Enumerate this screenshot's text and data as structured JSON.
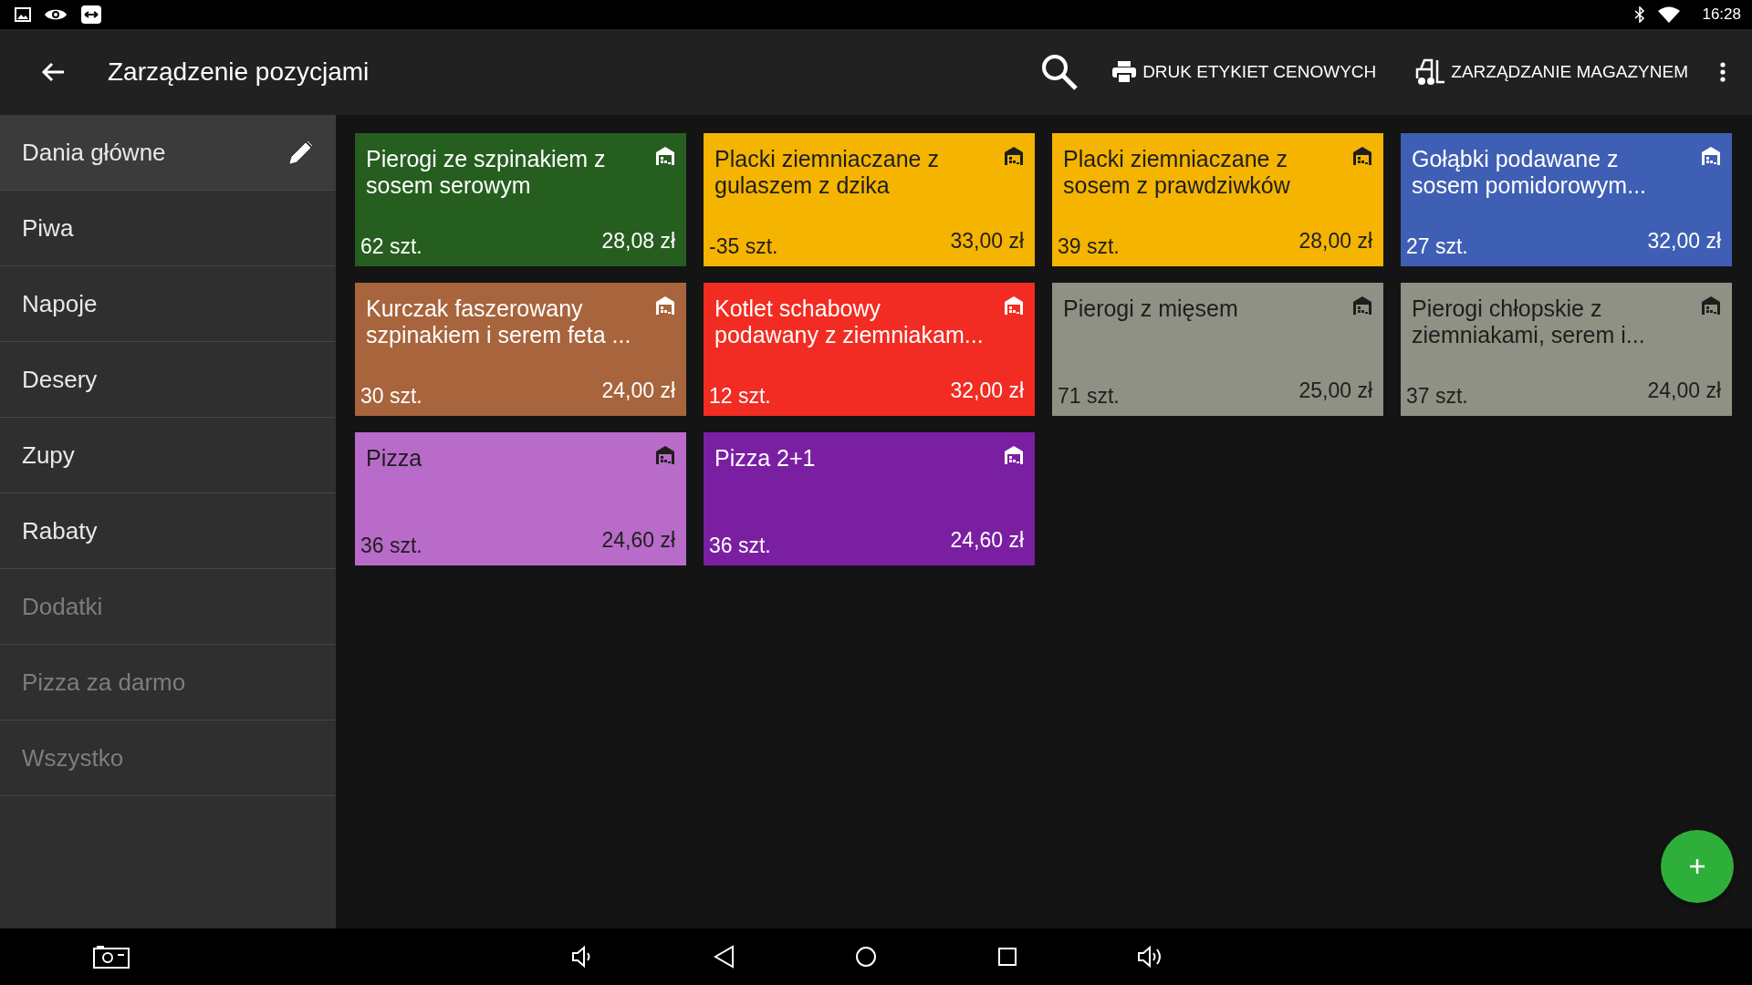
{
  "status_bar": {
    "time": "16:28"
  },
  "toolbar": {
    "title": "Zarządzenie pozycjami",
    "actions": [
      "DRUK ETYKIET CENOWYCH",
      "ZARZĄDZANIE MAGAZYNEM"
    ]
  },
  "sidebar": {
    "items": [
      {
        "label": "Dania główne",
        "selected": true,
        "disabled": false
      },
      {
        "label": "Piwa",
        "selected": false,
        "disabled": false
      },
      {
        "label": "Napoje",
        "selected": false,
        "disabled": false
      },
      {
        "label": "Desery",
        "selected": false,
        "disabled": false
      },
      {
        "label": "Zupy",
        "selected": false,
        "disabled": false
      },
      {
        "label": "Rabaty",
        "selected": false,
        "disabled": false
      },
      {
        "label": "Dodatki",
        "selected": false,
        "disabled": true
      },
      {
        "label": "Pizza za darmo",
        "selected": false,
        "disabled": true
      },
      {
        "label": "Wszystko",
        "selected": false,
        "disabled": true
      }
    ]
  },
  "products": [
    {
      "name": "Pierogi ze szpinakiem z sosem serowym",
      "stock": "62 szt.",
      "price": "28,08 zł",
      "color": "#265e20"
    },
    {
      "name": "Placki ziemniaczane z gulaszem z dzika",
      "stock": "-35 szt.",
      "price": "33,00 zł",
      "color": "#f4b400"
    },
    {
      "name": "Placki ziemniaczane z sosem z prawdziwków",
      "stock": "39 szt.",
      "price": "28,00 zł",
      "color": "#f4b400"
    },
    {
      "name": "Gołąbki podawane z sosem pomidorowym...",
      "stock": "27 szt.",
      "price": "32,00 zł",
      "color": "#3f5fb5"
    },
    {
      "name": "Kurczak faszerowany szpinakiem i serem feta ...",
      "stock": "30 szt.",
      "price": "24,00 zł",
      "color": "#a8643c"
    },
    {
      "name": "Kotlet schabowy podawany z ziemniakam...",
      "stock": "12 szt.",
      "price": "32,00 zł",
      "color": "#f22c22"
    },
    {
      "name": "Pierogi z mięsem",
      "stock": "71 szt.",
      "price": "25,00 zł",
      "color": "#8e9183"
    },
    {
      "name": "Pierogi chłopskie z ziemniakami, serem i...",
      "stock": "37 szt.",
      "price": "24,00 zł",
      "color": "#8e9183"
    },
    {
      "name": "Pizza",
      "stock": "36 szt.",
      "price": "24,60 zł",
      "color": "#b96bc9"
    },
    {
      "name": "Pizza 2+1",
      "stock": "36 szt.",
      "price": "24,60 zł",
      "color": "#7b1fa2"
    }
  ]
}
